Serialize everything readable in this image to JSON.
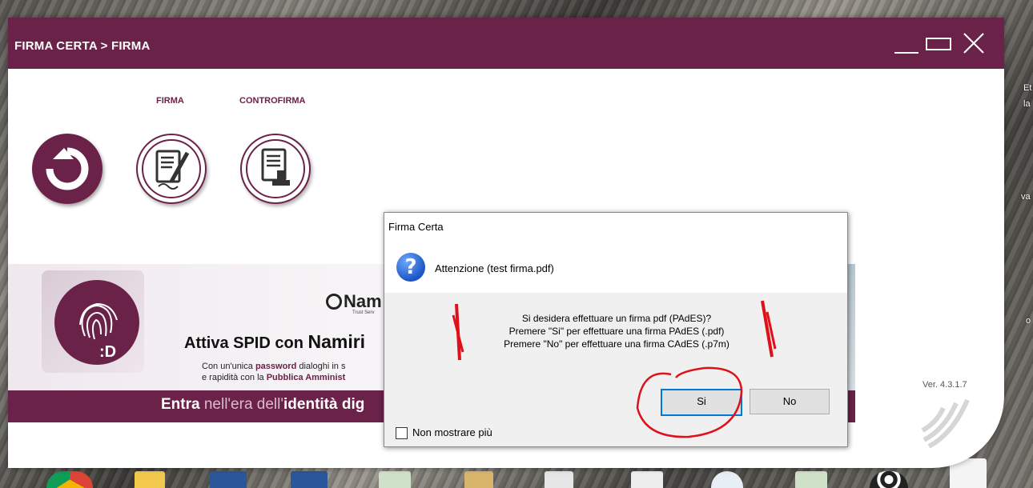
{
  "app": {
    "title": "FIRMA CERTA > FIRMA",
    "tabs": [
      "FIRMA",
      "CONTROFIRMA"
    ],
    "version": "Ver. 4.3.1.7"
  },
  "banner": {
    "logo_text": "Nam",
    "logo_sub": "Trust Serv",
    "headline_prefix": "Attiva SPID con ",
    "headline_brand": "Namiri",
    "line1_a": "Con un'unica ",
    "line1_b": "password",
    "line1_c": " dialoghi in s",
    "line2_a": "e rapidità con la ",
    "line2_b": "Pubblica Amminist",
    "bar_a": "Entra",
    "bar_b": " nell'era dell'",
    "bar_c": "identità dig"
  },
  "dialog": {
    "title": "Firma Certa",
    "heading": "Attenzione (test firma.pdf)",
    "message": [
      "Si desidera effettuare un firma pdf (PAdES)?",
      "Premere \"Si\" per effettuare una firma PAdES (.pdf)",
      "Premere \"No\" per effettuare una firma CAdES (.p7m)"
    ],
    "yes_label": "Si",
    "no_label": "No",
    "checkbox_label": "Non mostrare più"
  },
  "desktop": {
    "side_texts": [
      "Et",
      "la",
      "va",
      "o"
    ]
  },
  "colors": {
    "brand": "#6b2248",
    "dialog_bg": "#f0f0f0",
    "accent": "#0078d7",
    "annotation": "#e0101a"
  }
}
